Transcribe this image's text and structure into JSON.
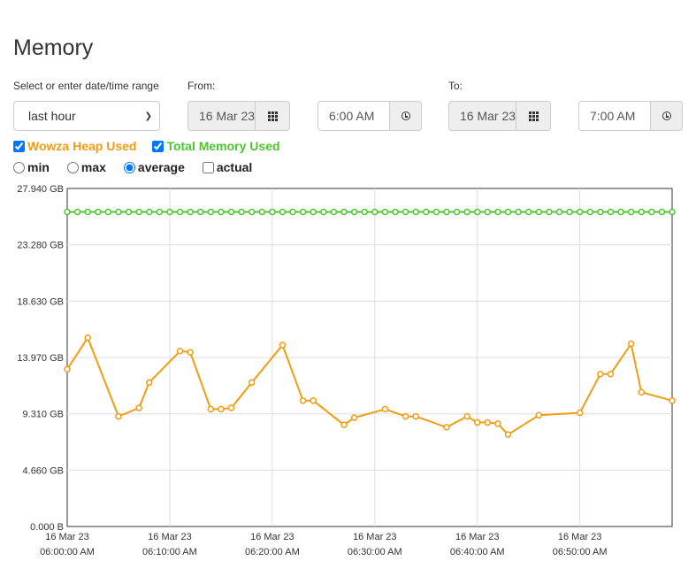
{
  "page": {
    "title": "Memory"
  },
  "range": {
    "label": "Select or enter date/time range",
    "selected": "last hour"
  },
  "from": {
    "label": "From:",
    "date": "16 Mar 23",
    "time": "6:00 AM"
  },
  "to": {
    "label": "To:",
    "date": "16 Mar 23",
    "time": "7:00 AM"
  },
  "series_toggles": [
    {
      "label": "Wowza Heap Used",
      "checked": true,
      "color": "#f39c12"
    },
    {
      "label": "Total Memory Used",
      "checked": true,
      "color": "#4cc62f"
    }
  ],
  "modes": [
    {
      "label": "min",
      "checked": false
    },
    {
      "label": "max",
      "checked": false
    },
    {
      "label": "average",
      "checked": true
    },
    {
      "label": "actual",
      "checked": false
    }
  ],
  "chart_data": {
    "type": "line",
    "ylim": [
      0,
      27.94
    ],
    "y_ticks": [
      {
        "value": 0,
        "label": "0.000 B"
      },
      {
        "value": 4.66,
        "label": "4.660 GB"
      },
      {
        "value": 9.31,
        "label": "9.310 GB"
      },
      {
        "value": 13.97,
        "label": "13.970 GB"
      },
      {
        "value": 18.63,
        "label": "18.630 GB"
      },
      {
        "value": 23.28,
        "label": "23.280 GB"
      },
      {
        "value": 27.94,
        "label": "27.940 GB"
      }
    ],
    "xlim": [
      0,
      59
    ],
    "x_ticks": [
      {
        "value": 0,
        "line1": "16 Mar 23",
        "line2": "06:00:00 AM"
      },
      {
        "value": 10,
        "line1": "16 Mar 23",
        "line2": "06:10:00 AM"
      },
      {
        "value": 20,
        "line1": "16 Mar 23",
        "line2": "06:20:00 AM"
      },
      {
        "value": 30,
        "line1": "16 Mar 23",
        "line2": "06:30:00 AM"
      },
      {
        "value": 40,
        "line1": "16 Mar 23",
        "line2": "06:40:00 AM"
      },
      {
        "value": 50,
        "line1": "16 Mar 23",
        "line2": "06:50:00 AM"
      }
    ],
    "series": [
      {
        "name": "Total Memory Used",
        "color": "#4cc62f",
        "points": [
          [
            0,
            26.0
          ],
          [
            1,
            26.0
          ],
          [
            2,
            26.0
          ],
          [
            3,
            26.0
          ],
          [
            4,
            26.0
          ],
          [
            5,
            26.0
          ],
          [
            6,
            26.0
          ],
          [
            7,
            26.0
          ],
          [
            8,
            26.0
          ],
          [
            9,
            26.0
          ],
          [
            10,
            26.0
          ],
          [
            11,
            26.0
          ],
          [
            12,
            26.0
          ],
          [
            13,
            26.0
          ],
          [
            14,
            26.0
          ],
          [
            15,
            26.0
          ],
          [
            16,
            26.0
          ],
          [
            17,
            26.0
          ],
          [
            18,
            26.0
          ],
          [
            19,
            26.0
          ],
          [
            20,
            26.0
          ],
          [
            21,
            26.0
          ],
          [
            22,
            26.0
          ],
          [
            23,
            26.0
          ],
          [
            24,
            26.0
          ],
          [
            25,
            26.0
          ],
          [
            26,
            26.0
          ],
          [
            27,
            26.0
          ],
          [
            28,
            26.0
          ],
          [
            29,
            26.0
          ],
          [
            30,
            26.0
          ],
          [
            31,
            26.0
          ],
          [
            32,
            26.0
          ],
          [
            33,
            26.0
          ],
          [
            34,
            26.0
          ],
          [
            35,
            26.0
          ],
          [
            36,
            26.0
          ],
          [
            37,
            26.0
          ],
          [
            38,
            26.0
          ],
          [
            39,
            26.0
          ],
          [
            40,
            26.0
          ],
          [
            41,
            26.0
          ],
          [
            42,
            26.0
          ],
          [
            43,
            26.0
          ],
          [
            44,
            26.0
          ],
          [
            45,
            26.0
          ],
          [
            46,
            26.0
          ],
          [
            47,
            26.0
          ],
          [
            48,
            26.0
          ],
          [
            49,
            26.0
          ],
          [
            50,
            26.0
          ],
          [
            51,
            26.0
          ],
          [
            52,
            26.0
          ],
          [
            53,
            26.0
          ],
          [
            54,
            26.0
          ],
          [
            55,
            26.0
          ],
          [
            56,
            26.0
          ],
          [
            57,
            26.0
          ],
          [
            58,
            26.0
          ],
          [
            59,
            26.0
          ]
        ]
      },
      {
        "name": "Wowza Heap Used",
        "color": "#f39c12",
        "points": [
          [
            0,
            13.0
          ],
          [
            2,
            15.6
          ],
          [
            5,
            9.1
          ],
          [
            7,
            9.8
          ],
          [
            8,
            11.9
          ],
          [
            11,
            14.5
          ],
          [
            12,
            14.4
          ],
          [
            14,
            9.7
          ],
          [
            15,
            9.7
          ],
          [
            16,
            9.8
          ],
          [
            18,
            11.9
          ],
          [
            21,
            15.0
          ],
          [
            23,
            10.4
          ],
          [
            24,
            10.4
          ],
          [
            27,
            8.4
          ],
          [
            28,
            9.0
          ],
          [
            31,
            9.7
          ],
          [
            33,
            9.1
          ],
          [
            34,
            9.1
          ],
          [
            37,
            8.2
          ],
          [
            39,
            9.1
          ],
          [
            40,
            8.6
          ],
          [
            41,
            8.6
          ],
          [
            42,
            8.5
          ],
          [
            43,
            7.6
          ],
          [
            46,
            9.2
          ],
          [
            50,
            9.4
          ],
          [
            52,
            12.6
          ],
          [
            53,
            12.6
          ],
          [
            55,
            15.1
          ],
          [
            56,
            11.1
          ],
          [
            59,
            10.4
          ]
        ]
      }
    ]
  }
}
